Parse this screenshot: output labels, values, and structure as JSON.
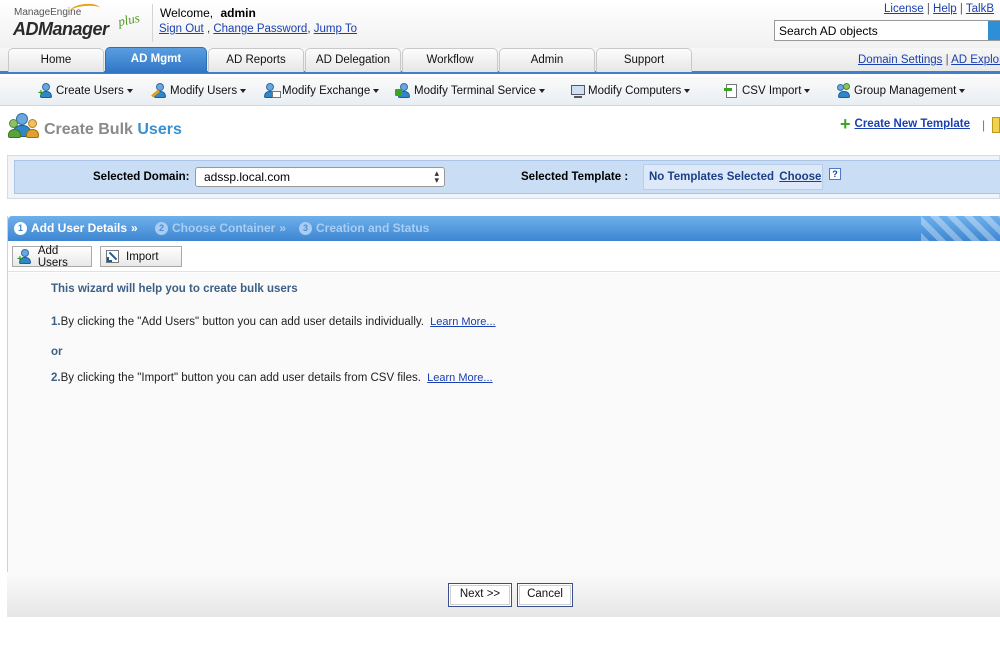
{
  "header": {
    "brand_top": "ManageEngine",
    "brand_main": "ADManager",
    "brand_plus": "plus",
    "welcome_label": "Welcome,",
    "username": "admin",
    "sign_out": "Sign Out",
    "link_sep": ",",
    "change_password": "Change Password",
    "jump_to": "Jump To",
    "top_links": [
      "License",
      "Help",
      "TalkB"
    ],
    "pipe": "|",
    "search_placeholder": "Search AD objects"
  },
  "tabs": [
    {
      "label": "Home",
      "active": false
    },
    {
      "label": "AD Mgmt",
      "active": true
    },
    {
      "label": "AD Reports",
      "active": false
    },
    {
      "label": "AD Delegation",
      "active": false
    },
    {
      "label": "Workflow",
      "active": false
    },
    {
      "label": "Admin",
      "active": false
    },
    {
      "label": "Support",
      "active": false
    }
  ],
  "tab_right_links": [
    "Domain Settings",
    "AD Explor"
  ],
  "submenu": [
    {
      "label": "Create Users",
      "icon": "user-add-icon"
    },
    {
      "label": "Modify Users",
      "icon": "user-edit-icon"
    },
    {
      "label": "Modify Exchange",
      "icon": "exchange-icon"
    },
    {
      "label": "Modify Terminal Service",
      "icon": "terminal-service-icon"
    },
    {
      "label": "Modify Computers",
      "icon": "computer-icon"
    },
    {
      "label": "CSV Import",
      "icon": "csv-import-icon"
    },
    {
      "label": "Group Management",
      "icon": "group-icon"
    }
  ],
  "page": {
    "title_prefix": "Create Bulk",
    "title_highlight": "Users",
    "create_template": "Create New Template",
    "sep": "|"
  },
  "domain": {
    "label": "Selected Domain:",
    "value": "adssp.local.com",
    "template_label": "Selected Template :",
    "template_value": "No Templates Selected",
    "choose": "Choose",
    "help": "?"
  },
  "wizard": {
    "steps": [
      {
        "num": "1",
        "label": "Add User Details",
        "active": true
      },
      {
        "num": "2",
        "label": "Choose Container",
        "active": false
      },
      {
        "num": "3",
        "label": "Creation and Status",
        "active": false
      }
    ],
    "step_sep": "»",
    "add_users": "Add Users",
    "import": "Import",
    "intro": "This wizard will help you to create bulk users",
    "line1_num": "1.",
    "line1_text": "By clicking the \"Add Users\" button you can add user details individually.",
    "learn_more": "Learn More...",
    "or": "or",
    "line2_num": "2.",
    "line2_text": "By clicking the \"Import\" button you can add user details from CSV files.",
    "next": "Next >>",
    "cancel": "Cancel"
  },
  "colors": {
    "accent_blue": "#3d86d1",
    "title_blue": "#3a8fd0",
    "link_blue": "#1a3fb0",
    "plus_green": "#3aa520"
  }
}
